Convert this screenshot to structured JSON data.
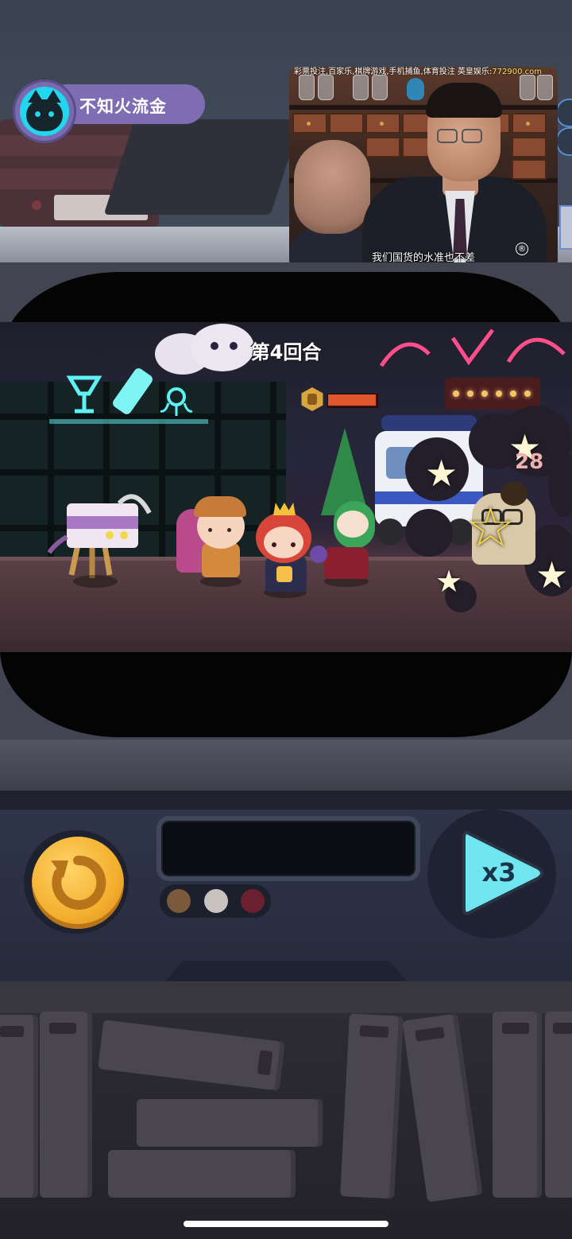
{
  "player": {
    "name": "不知火流金",
    "avatar_icon": "cat-face-icon"
  },
  "video_overlay": {
    "ticker_text": "彩票投注,百家乐,棋牌游戏,手机捕鱼,体育投注 英皇娱乐:",
    "ticker_site": "772900.com",
    "subtitle": "我们国货的水准也不差",
    "registered_mark": "®"
  },
  "battle": {
    "round_label": "第4回合",
    "enemy_hp_icon": "hexagon-shield-icon",
    "enemy_hp_fraction": 1.0,
    "floating_number": "28"
  },
  "controls": {
    "retry_icon": "circular-arrow-icon",
    "speed_label": "x3",
    "speed_icon": "play-triangle-icon",
    "led_colors": [
      "#7a5a3a",
      "#c9c4bf",
      "#6b2030"
    ]
  },
  "colors": {
    "player_tag": "#7e6db3",
    "avatar_bg": "#21d6ee",
    "retry_button": "#f3ae2d",
    "speed_button": "#6fe6f0",
    "hp_bar": "#e0562e"
  }
}
